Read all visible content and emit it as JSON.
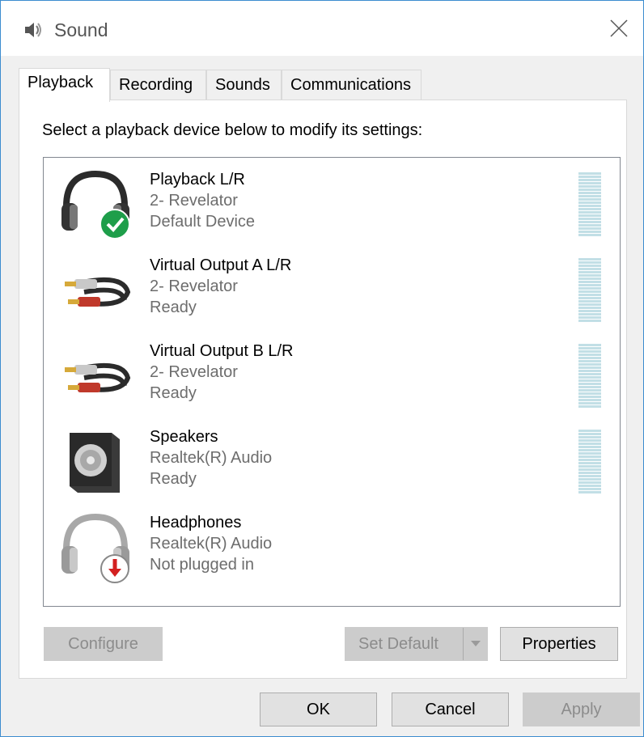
{
  "window": {
    "title": "Sound",
    "accent": "#3c8ccf"
  },
  "tabs": [
    {
      "label": "Playback",
      "active": true
    },
    {
      "label": "Recording",
      "active": false
    },
    {
      "label": "Sounds",
      "active": false
    },
    {
      "label": "Communications",
      "active": false
    }
  ],
  "playback": {
    "instruction": "Select a playback device below to modify its settings:",
    "devices": [
      {
        "name": "Playback L/R",
        "driver": "2- Revelator",
        "status": "Default Device",
        "icon": "headphones-default-icon"
      },
      {
        "name": "Virtual Output A L/R",
        "driver": "2- Revelator",
        "status": "Ready",
        "icon": "rca-cable-icon"
      },
      {
        "name": "Virtual Output B L/R",
        "driver": "2- Revelator",
        "status": "Ready",
        "icon": "rca-cable-icon"
      },
      {
        "name": "Speakers",
        "driver": "Realtek(R) Audio",
        "status": "Ready",
        "icon": "speaker-icon"
      },
      {
        "name": "Headphones",
        "driver": "Realtek(R) Audio",
        "status": "Not plugged in",
        "icon": "headphones-unplugged-icon"
      }
    ],
    "buttons": {
      "configure": "Configure",
      "set_default": "Set Default",
      "properties": "Properties"
    }
  },
  "footer": {
    "ok": "OK",
    "cancel": "Cancel",
    "apply": "Apply"
  },
  "colors": {
    "meter": "#c2dfe6",
    "status_ok": "#1e9e4a",
    "status_unplugged": "#d32020"
  }
}
